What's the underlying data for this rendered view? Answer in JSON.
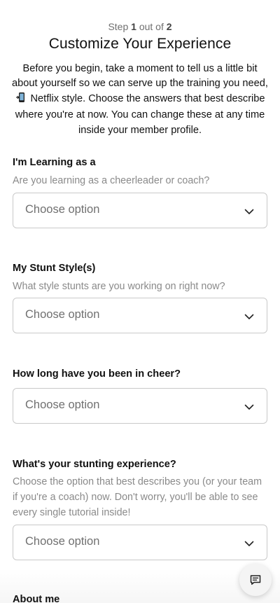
{
  "header": {
    "step_prefix": "Step",
    "step_current": "1",
    "step_middle": "out of",
    "step_total": "2",
    "title": "Customize Your Experience",
    "intro_before_icon": "Before you begin, take a moment to tell us a little bit about yourself so we can serve up the training you need,",
    "intro_icon": "mobile-phone-icon",
    "intro_after_icon": "Netflix style. Choose the answers that best describe where you're at now. You can change these at any time inside your member profile."
  },
  "questions": [
    {
      "label": "I'm Learning as a",
      "help": "Are you learning as a cheerleader or coach?",
      "placeholder": "Choose option"
    },
    {
      "label": "My Stunt Style(s)",
      "help": "What style stunts are you working on right now?",
      "placeholder": "Choose option"
    },
    {
      "label": "How long have you been in cheer?",
      "help": "",
      "placeholder": "Choose option"
    },
    {
      "label": "What's your stunting experience?",
      "help": "Choose the option that best describes you (or your team if you're a coach) now. Don't worry, you'll be able to see every single tutorial inside!",
      "placeholder": "Choose option"
    },
    {
      "label": "About me"
    }
  ],
  "chat_button": {
    "icon": "chat-bubble-icon"
  },
  "colors": {
    "text": "#111111",
    "muted": "#8a8a8a",
    "border": "#c9c9c9"
  }
}
